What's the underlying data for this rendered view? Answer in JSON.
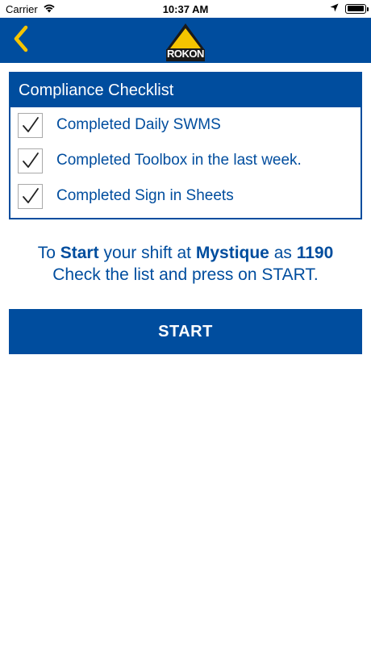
{
  "status_bar": {
    "carrier": "Carrier",
    "time": "10:37 AM"
  },
  "nav": {
    "logo_text": "ROKON"
  },
  "checklist": {
    "title": "Compliance Checklist",
    "items": [
      {
        "label": "Completed Daily SWMS",
        "checked": true
      },
      {
        "label": "Completed Toolbox in the last week.",
        "checked": true
      },
      {
        "label": "Completed Sign in Sheets",
        "checked": true
      }
    ]
  },
  "instruction": {
    "prefix": "To",
    "action": "Start",
    "middle": "your shift at",
    "site": "Mystique",
    "as_word": "as",
    "id": "1190",
    "line2": "Check the list and press on START."
  },
  "start_button": {
    "label": "START"
  },
  "colors": {
    "primary": "#004d9e",
    "accent": "#f5c400",
    "background": "#ffffff"
  }
}
